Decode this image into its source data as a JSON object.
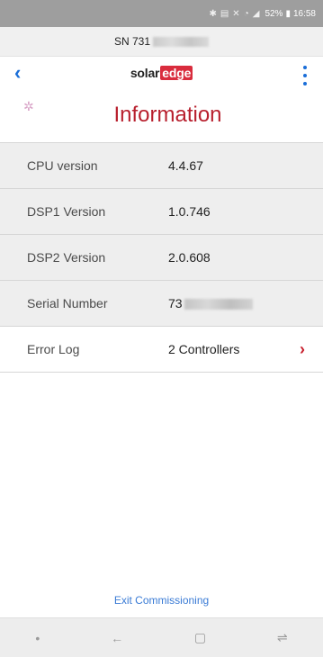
{
  "status_bar": {
    "battery": "52%",
    "time": "16:58"
  },
  "device": {
    "sn_prefix": "SN 731"
  },
  "nav": {
    "logo_solar": "solar",
    "logo_edge": "edge"
  },
  "page": {
    "title": "Information"
  },
  "info_rows": [
    {
      "label": "CPU version",
      "value": "4.4.67"
    },
    {
      "label": "DSP1 Version",
      "value": "1.0.746"
    },
    {
      "label": "DSP2 Version",
      "value": "2.0.608"
    },
    {
      "label": "Serial Number",
      "value": "73"
    },
    {
      "label": "Error Log",
      "value": "2 Controllers"
    }
  ],
  "footer": {
    "exit_label": "Exit Commissioning"
  },
  "colors": {
    "accent": "#1a6ed8",
    "brand_red": "#b8202e",
    "link_blue": "#3a7bd5"
  }
}
